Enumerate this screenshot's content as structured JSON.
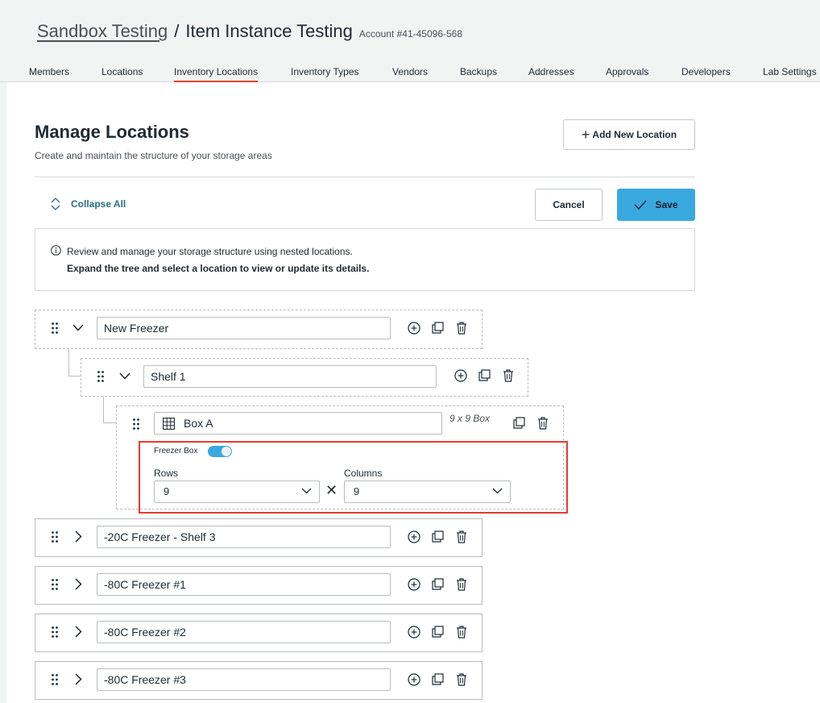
{
  "header": {
    "breadcrumb_parent": "Sandbox Testing",
    "breadcrumb_separator": "/",
    "page_title": "Item Instance Testing",
    "account_label": "Account #41-45096-568"
  },
  "tabs": [
    {
      "label": "Members",
      "active": false
    },
    {
      "label": "Locations",
      "active": false
    },
    {
      "label": "Inventory Locations",
      "active": true
    },
    {
      "label": "Inventory Types",
      "active": false
    },
    {
      "label": "Vendors",
      "active": false
    },
    {
      "label": "Backups",
      "active": false
    },
    {
      "label": "Addresses",
      "active": false
    },
    {
      "label": "Approvals",
      "active": false
    },
    {
      "label": "Developers",
      "active": false
    },
    {
      "label": "Lab Settings",
      "active": false
    }
  ],
  "manage": {
    "title": "Manage Locations",
    "subtitle": "Create and maintain the structure of your storage areas",
    "add_button": "Add New Location",
    "collapse_all": "Collapse All",
    "cancel": "Cancel",
    "save": "Save"
  },
  "info": {
    "line1": "Review and manage your storage structure using nested locations.",
    "line2": "Expand the tree and select a location to view or update its details."
  },
  "tree": {
    "new_freezer": "New Freezer",
    "shelf_1": "Shelf 1",
    "box_a": "Box A",
    "box_dims": "9 x 9 Box",
    "freezer_box_label": "Freezer Box",
    "freezer_box_enabled": true,
    "rows_label": "Rows",
    "rows_value": "9",
    "times": "✕",
    "columns_label": "Columns",
    "columns_value": "9",
    "collapsed_items": [
      "-20C Freezer - Shelf 3",
      "-80C Freezer #1",
      "-80C Freezer #2",
      "-80C Freezer #3"
    ]
  },
  "colors": {
    "accent": "#39a8df",
    "active_tab": "#e2472f",
    "highlight": "#e83a2f",
    "link": "#2a6f86"
  }
}
